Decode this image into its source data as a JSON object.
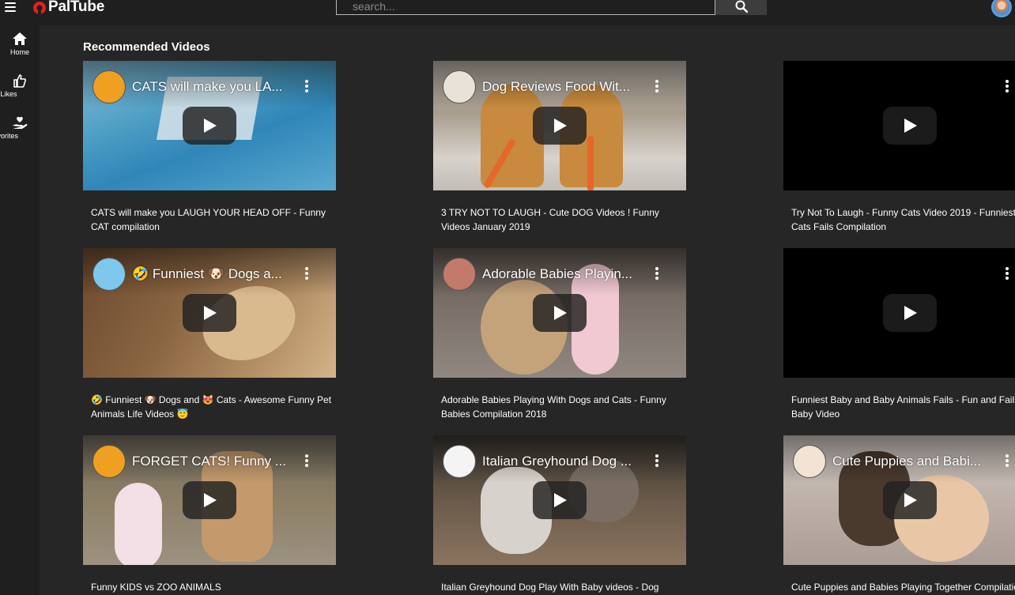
{
  "app": {
    "name": "PalTube",
    "brand_color": "#e02020"
  },
  "search": {
    "placeholder": "search...",
    "icon": "search-icon"
  },
  "sidebar": {
    "items": [
      {
        "label": "Home",
        "icon": "home-icon"
      },
      {
        "label": "My Likes",
        "icon": "thumbs-up-icon"
      },
      {
        "label": "Favorites",
        "icon": "heart-hand-icon"
      }
    ]
  },
  "main": {
    "heading": "Recommended Videos",
    "videos": [
      {
        "overlay_title": "CATS will make you LA...",
        "title": "CATS will make you LAUGH YOUR HEAD OFF - Funny CAT compilation"
      },
      {
        "overlay_title": "Dog Reviews Food Wit...",
        "title": "3 TRY NOT TO LAUGH - Cute DOG Videos ! Funny Videos January 2019"
      },
      {
        "overlay_title": "",
        "title": "Try Not To Laugh - Funny Cats Video 2019 - Funniest Cats Fails Compilation"
      },
      {
        "overlay_title": "🤣 Funniest 🐶 Dogs a...",
        "title": "🤣 Funniest 🐶 Dogs and 😻 Cats - Awesome Funny Pet Animals Life Videos 😇"
      },
      {
        "overlay_title": "Adorable Babies Playin...",
        "title": "Adorable Babies Playing With Dogs and Cats - Funny Babies Compilation 2018"
      },
      {
        "overlay_title": "",
        "title": "Funniest Baby and Baby Animals Fails - Fun and Fails Baby Video"
      },
      {
        "overlay_title": "FORGET CATS! Funny ...",
        "title": "Funny KIDS vs ZOO ANIMALS"
      },
      {
        "overlay_title": "Italian Greyhound Dog ...",
        "title": "Italian Greyhound Dog Play With Baby videos - Dog"
      },
      {
        "overlay_title": "Cute Puppies and Babi...",
        "title": "Cute Puppies and Babies Playing Together Compilation"
      }
    ]
  }
}
